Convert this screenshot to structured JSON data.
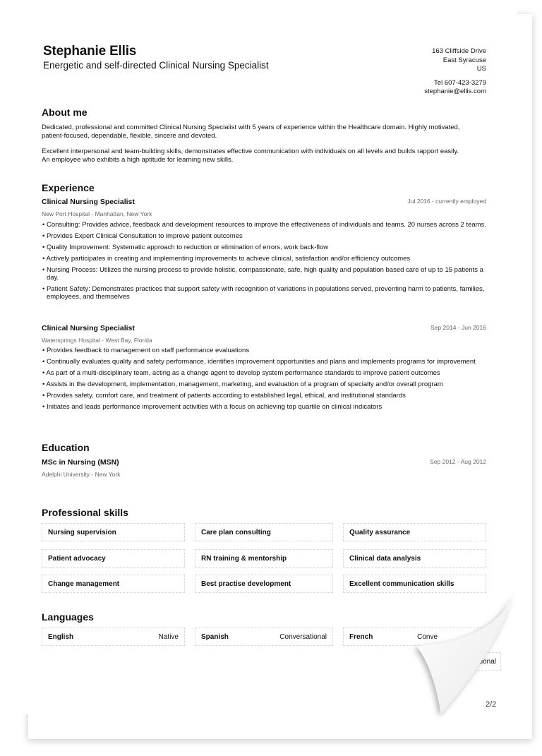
{
  "header": {
    "name": "Stephanie Ellis",
    "tagline": "Energetic and self-directed Clinical Nursing Specialist",
    "contact": {
      "street": "163 Cliffside Drive",
      "city": "East Syracuse",
      "country": "US",
      "phone": "Tel 607-423-3279",
      "email": "stephanie@ellis.com"
    }
  },
  "about": {
    "title": "About me",
    "paragraphs": [
      "Dedicated, professional and committed Clinical Nursing Specialist with 5 years of experience within the Healthcare domain. Highly motivated, patient-focused, dependable, flexible, sincere and devoted.",
      "Excellent interpersonal and team-building skills, demonstrates effective communication with individuals on all levels and builds rapport easily. An employee who exhibits a high aptitude for learning new skills."
    ]
  },
  "experience": {
    "title": "Experience",
    "jobs": [
      {
        "title": "Clinical Nursing Specialist",
        "date": "Jul 2016 - currently employed",
        "org": "New Port Hospital - Manhattan, New York",
        "bullets": [
          "Consulting: Provides advice, feedback and development resources to improve the effectiveness of individuals and teams. 20 nurses across 2 teams.",
          "Provides Expert Clinical Consultation to improve patient outcomes",
          "Quality Improvement: Systematic approach to reduction or elimination of errors, work back-flow",
          "Actively participates in creating and implementing improvements to achieve clinical, satisfaction and/or efficiency outcomes",
          "Nursing Process: Utilizes the nursing process to provide holistic, compassionate, safe, high quality and population based care of up to 15 patients a day.",
          "Patient Safety: Demonstrates practices that support safety with recognition of variations in populations served, preventing harm to patients, families, employees, and themselves"
        ]
      },
      {
        "title": "Clinical Nursing Specialist",
        "date": "Sep 2014 - Jun 2016",
        "org": "Watersprings Hospital - West Bay, Florida",
        "bullets": [
          "Provides feedback to management on staff performance evaluations",
          "Continually evaluates quality and safety performance, identifies improvement opportunities and plans and implements programs for improvement",
          "As part of a multi-disciplinary team, acting as a change agent to develop system performance standards to improve patient outcomes",
          "Assists in the development, implementation, management, marketing, and evaluation of a program of specialty and/or overall program",
          "Provides safety, comfort care, and treatment of patients according to established legal, ethical, and institutional standards",
          "Initiates and leads performance improvement activities with a focus on achieving top quartile on clinical indicators"
        ]
      }
    ]
  },
  "education": {
    "title": "Education",
    "degree": "MSc in Nursing (MSN)",
    "date": "Sep 2012 - Aug 2012",
    "org": "Adelphi University - New York"
  },
  "skills": {
    "title": "Professional skills",
    "items": [
      "Nursing supervision",
      "Care plan consulting",
      "Quality assurance",
      "Patient advocacy",
      "RN training & mentorship",
      "Clinical data analysis",
      "Change management",
      "Best practise development",
      "Excellent communication skills"
    ]
  },
  "languages": {
    "title": "Languages",
    "items": [
      {
        "name": "English",
        "level": "Native"
      },
      {
        "name": "Spanish",
        "level": "Conversational"
      },
      {
        "name": "French",
        "level": "Conve"
      }
    ],
    "back_page_fragment": "sational"
  },
  "page_number": "2/2"
}
